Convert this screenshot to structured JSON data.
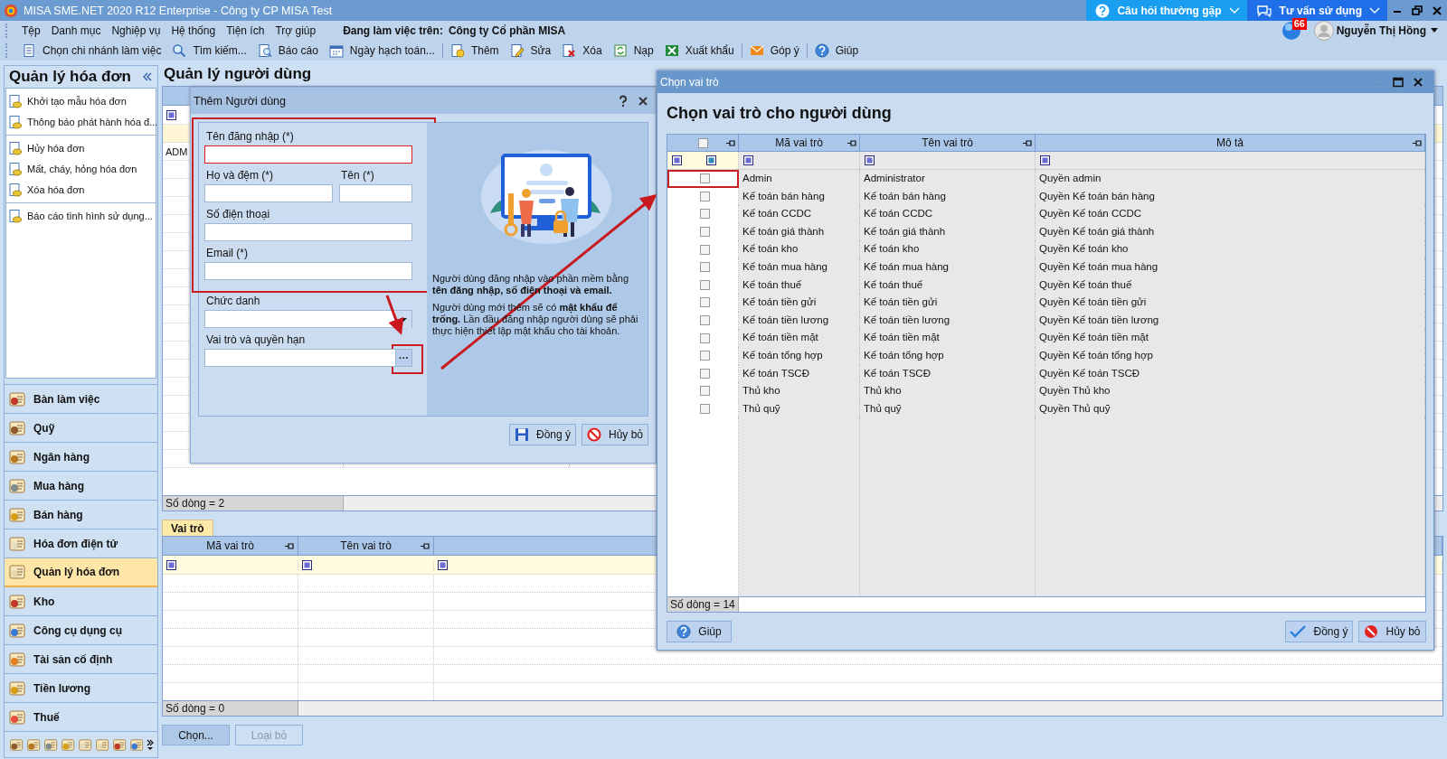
{
  "window": {
    "title": "MISA SME.NET 2020 R12 Enterprise - Công ty CP MISA Test",
    "help_buttons": [
      {
        "label": "Câu hỏi thường gặp",
        "color": "#1a9ff0"
      },
      {
        "label": "Tư vấn sử dụng",
        "color": "#1f6fe8"
      }
    ]
  },
  "menu": [
    "Tệp",
    "Danh mục",
    "Nghiệp vụ",
    "Hệ thống",
    "Tiện ích",
    "Trợ giúp"
  ],
  "workspace": {
    "label": "Đang làm việc trên:",
    "company": "Công ty Cổ phần MISA"
  },
  "user": {
    "name": "Nguyễn Thị Hồng",
    "notifications": "66"
  },
  "toolbar": {
    "groups": [
      [
        "Chọn chi nhánh làm việc",
        "Tìm kiếm...",
        "Báo cáo",
        "Ngày hạch toán..."
      ],
      [
        "Thêm",
        "Sửa",
        "Xóa",
        "Nạp",
        "Xuất khẩu"
      ],
      [
        "Góp ý"
      ],
      [
        "Giúp"
      ]
    ]
  },
  "sidebar": {
    "title": "Quản lý hóa đơn",
    "groups": [
      [
        "Khởi tạo mẫu hóa đơn",
        "Thông báo phát hành hóa đ..."
      ],
      [
        "Hủy hóa đơn",
        "Mất, cháy, hỏng hóa đơn",
        "Xóa hóa đơn"
      ],
      [
        "Báo cáo tình hình sử dụng..."
      ]
    ],
    "modules": [
      {
        "label": "Bàn làm việc",
        "selected": false
      },
      {
        "label": "Quỹ",
        "selected": false
      },
      {
        "label": "Ngân hàng",
        "selected": false
      },
      {
        "label": "Mua hàng",
        "selected": false
      },
      {
        "label": "Bán hàng",
        "selected": false
      },
      {
        "label": "Hóa đơn điện tử",
        "selected": false
      },
      {
        "label": "Quản lý hóa đơn",
        "selected": true
      },
      {
        "label": "Kho",
        "selected": false
      },
      {
        "label": "Công cụ dụng cụ",
        "selected": false
      },
      {
        "label": "Tài sản cố định",
        "selected": false
      },
      {
        "label": "Tiền lương",
        "selected": false
      },
      {
        "label": "Thuế",
        "selected": false
      }
    ]
  },
  "page": {
    "title": "Quản lý người dùng",
    "users_table": {
      "rows": [
        {
          "selected": true
        },
        {
          "selected": false,
          "column_1": "ADM"
        }
      ],
      "footer": "Số dòng = 2"
    },
    "tabs": [
      {
        "label": "Vai trò",
        "selected": true
      }
    ],
    "roles_table": {
      "columns": [
        "Mã vai trò",
        "Tên vai trò"
      ],
      "footer": "Số dòng = 0"
    },
    "buttons": [
      {
        "label": "Chọn...",
        "disabled": false
      },
      {
        "label": "Loại bỏ",
        "disabled": true
      }
    ]
  },
  "add_user_dialog": {
    "title": "Thêm Người dùng",
    "highlighted_fields": [
      {
        "label": "Tên đăng nhập (*)",
        "invalid": true
      },
      {
        "kind": "pair",
        "fields": [
          {
            "label": "Họ và đệm (*)",
            "invalid": false
          },
          {
            "label": "Tên (*)",
            "invalid": false
          }
        ]
      },
      {
        "label": "Số điện thoại",
        "invalid": false
      },
      {
        "label": "Email (*)",
        "invalid": false
      }
    ],
    "other_fields": [
      {
        "kind": "combo",
        "label": "Chức danh",
        "highlighted": false
      },
      {
        "kind": "picker",
        "label": "Vai trò và quyền hạn",
        "button": "···",
        "highlighted": true
      }
    ],
    "info": [
      "Người dùng đăng nhập vào phần mềm bằng **tên đăng nhập, số điện thoại và email.**",
      "Người dùng mới thêm sẽ có  **mật khẩu để trống.** Lần đầu đăng nhập người dùng sẽ phải thực hiện thiết lập mật khẩu cho tài khoản."
    ],
    "buttons": [
      "Đồng ý",
      "Hủy bỏ"
    ]
  },
  "role_dialog": {
    "title": "Chọn vai trò",
    "heading": "Chọn vai trò cho người dùng",
    "select_all": {
      "checked": false
    },
    "columns": [
      "Mã vai trò",
      "Tên vai trò",
      "Mô tả"
    ],
    "rows": [
      {
        "code": "Admin",
        "name": "Administrator",
        "description": "Quyền admin",
        "checked": false,
        "highlighted": true
      },
      {
        "code": "Kế toán bán hàng",
        "name": "Kế toán bán hàng",
        "description": "Quyền Kế toán bán hàng",
        "checked": false,
        "highlighted": false
      },
      {
        "code": "Kế toán CCDC",
        "name": "Kế toán CCDC",
        "description": "Quyền Kế toán CCDC",
        "checked": false,
        "highlighted": false
      },
      {
        "code": "Kế toán giá thành",
        "name": "Kế toán giá thành",
        "description": "Quyền Kế toán giá thành",
        "checked": false,
        "highlighted": false
      },
      {
        "code": "Kế toán kho",
        "name": "Kế toán kho",
        "description": "Quyền Kế toán kho",
        "checked": false,
        "highlighted": false
      },
      {
        "code": "Kế toán mua hàng",
        "name": "Kế toán mua hàng",
        "description": "Quyền Kế toán mua hàng",
        "checked": false,
        "highlighted": false
      },
      {
        "code": "Kế toán thuế",
        "name": "Kế toán thuế",
        "description": "Quyền Kế toán thuế",
        "checked": false,
        "highlighted": false
      },
      {
        "code": "Kế toán tiền gửi",
        "name": "Kế toán tiền gửi",
        "description": "Quyền Kế toán tiền gửi",
        "checked": false,
        "highlighted": false
      },
      {
        "code": "Kế toán tiền lương",
        "name": "Kế toán tiền lương",
        "description": "Quyền Kế toán tiền lương",
        "checked": false,
        "highlighted": false
      },
      {
        "code": "Kế toán tiền mặt",
        "name": "Kế toán tiền mặt",
        "description": "Quyền Kế toán tiền mặt",
        "checked": false,
        "highlighted": false
      },
      {
        "code": "Kế toán tổng hợp",
        "name": "Kế toán tổng hợp",
        "description": "Quyền Kế toán tổng hợp",
        "checked": false,
        "highlighted": false
      },
      {
        "code": "Kế toán TSCĐ",
        "name": "Kế toán TSCĐ",
        "description": "Quyền Kế toán TSCĐ",
        "checked": false,
        "highlighted": false
      },
      {
        "code": "Thủ kho",
        "name": "Thủ kho",
        "description": "Quyền Thủ kho",
        "checked": false,
        "highlighted": false
      },
      {
        "code": "Thủ quỹ",
        "name": "Thủ quỹ",
        "description": "Quyền Thủ quỹ",
        "checked": false,
        "highlighted": false
      }
    ],
    "footer": "Số dòng = 14",
    "buttons": [
      {
        "label": "Giúp",
        "kind": "help"
      },
      {
        "label": "Đồng ý",
        "kind": "ok"
      },
      {
        "label": "Hủy bỏ",
        "kind": "cancel"
      }
    ]
  }
}
